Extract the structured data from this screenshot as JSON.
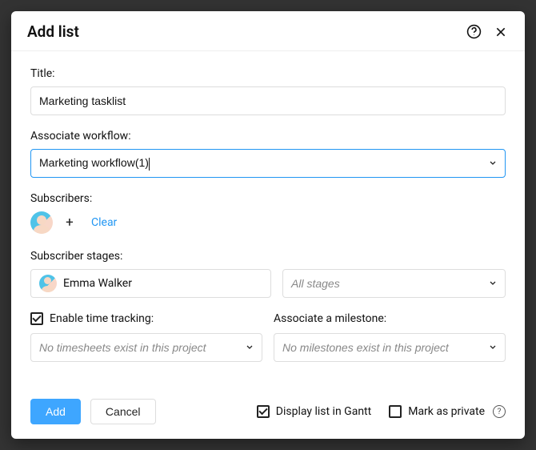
{
  "header": {
    "title": "Add list"
  },
  "fields": {
    "title_label": "Title:",
    "title_value": "Marketing tasklist",
    "workflow_label": "Associate workflow:",
    "workflow_value": "Marketing workflow(1)",
    "subscribers_label": "Subscribers:",
    "clear_label": "Clear",
    "plus_label": "+",
    "stages_label": "Subscriber stages:",
    "stage_user": "Emma Walker",
    "stage_select_placeholder": "All stages",
    "time_tracking_label": "Enable time tracking:",
    "timesheet_placeholder": "No timesheets exist in this project",
    "milestone_label": "Associate a milestone:",
    "milestone_placeholder": "No milestones exist in this project"
  },
  "footer": {
    "add_label": "Add",
    "cancel_label": "Cancel",
    "gantt_label": "Display list in Gantt",
    "private_label": "Mark as private"
  }
}
